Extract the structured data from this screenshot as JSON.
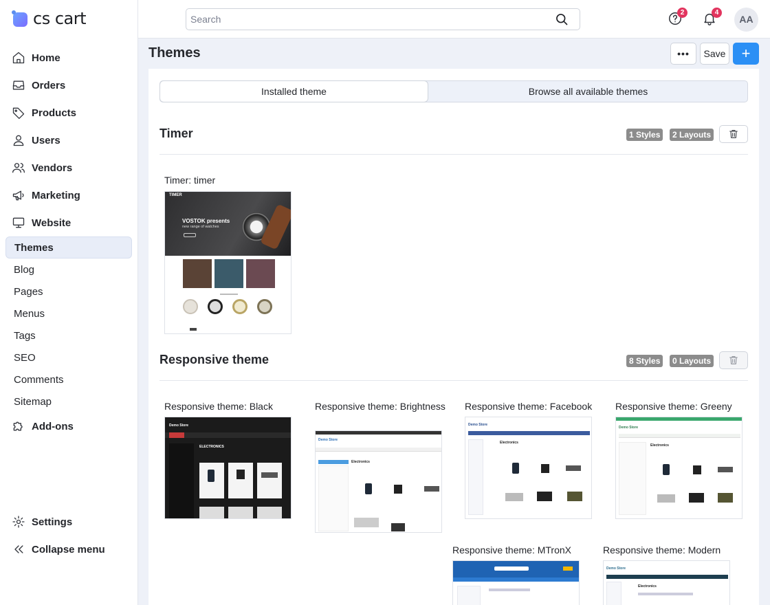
{
  "brand": {
    "name": "cs cart"
  },
  "sidebar": {
    "main_items": [
      {
        "label": "Home",
        "icon": "home-icon"
      },
      {
        "label": "Orders",
        "icon": "inbox-icon"
      },
      {
        "label": "Products",
        "icon": "tag-icon"
      },
      {
        "label": "Users",
        "icon": "user-icon"
      },
      {
        "label": "Vendors",
        "icon": "users-icon"
      },
      {
        "label": "Marketing",
        "icon": "megaphone-icon"
      },
      {
        "label": "Website",
        "icon": "monitor-icon"
      }
    ],
    "sub_items": [
      {
        "label": "Themes",
        "active": true
      },
      {
        "label": "Blog"
      },
      {
        "label": "Pages"
      },
      {
        "label": "Menus"
      },
      {
        "label": "Tags"
      },
      {
        "label": "SEO"
      },
      {
        "label": "Comments"
      },
      {
        "label": "Sitemap"
      }
    ],
    "addons": {
      "label": "Add-ons",
      "icon": "puzzle-icon"
    },
    "settings": {
      "label": "Settings",
      "icon": "gear-icon"
    },
    "collapse": {
      "label": "Collapse menu",
      "icon": "double-chevron-left-icon"
    }
  },
  "topbar": {
    "search_placeholder": "Search",
    "help_badge": "2",
    "notifications_badge": "4",
    "avatar_initials": "AA"
  },
  "page": {
    "title": "Themes",
    "more_label": "•••",
    "save_label": "Save",
    "add_label": "+"
  },
  "tabs": {
    "installed": "Installed theme",
    "browse": "Browse all available themes"
  },
  "themes": [
    {
      "name": "Timer",
      "styles": "1 Styles",
      "layouts": "2 Layouts",
      "styles_list": [
        "Timer: timer"
      ]
    },
    {
      "name": "Responsive theme",
      "styles": "8 Styles",
      "layouts": "0 Layouts",
      "styles_list": [
        "Responsive theme: Black",
        "Responsive theme: Brightness",
        "Responsive theme: Facebook",
        "Responsive theme: Greeny",
        "Responsive theme: MTronX",
        "Responsive theme: Modern"
      ]
    }
  ],
  "thumb_text": {
    "timer_brand": "TIMER",
    "timer_hero": "VOSTOK presents",
    "timer_hero_sub": "new range of watches",
    "demo_store": "Demo Store",
    "electronics": "ELECTRONICS",
    "electronics_alt": "Electronics"
  },
  "colors": {
    "accent": "#2b8ff5",
    "badge": "#e2345e",
    "pill": "#8c8c8c",
    "active_nav": "#e8edf8"
  }
}
